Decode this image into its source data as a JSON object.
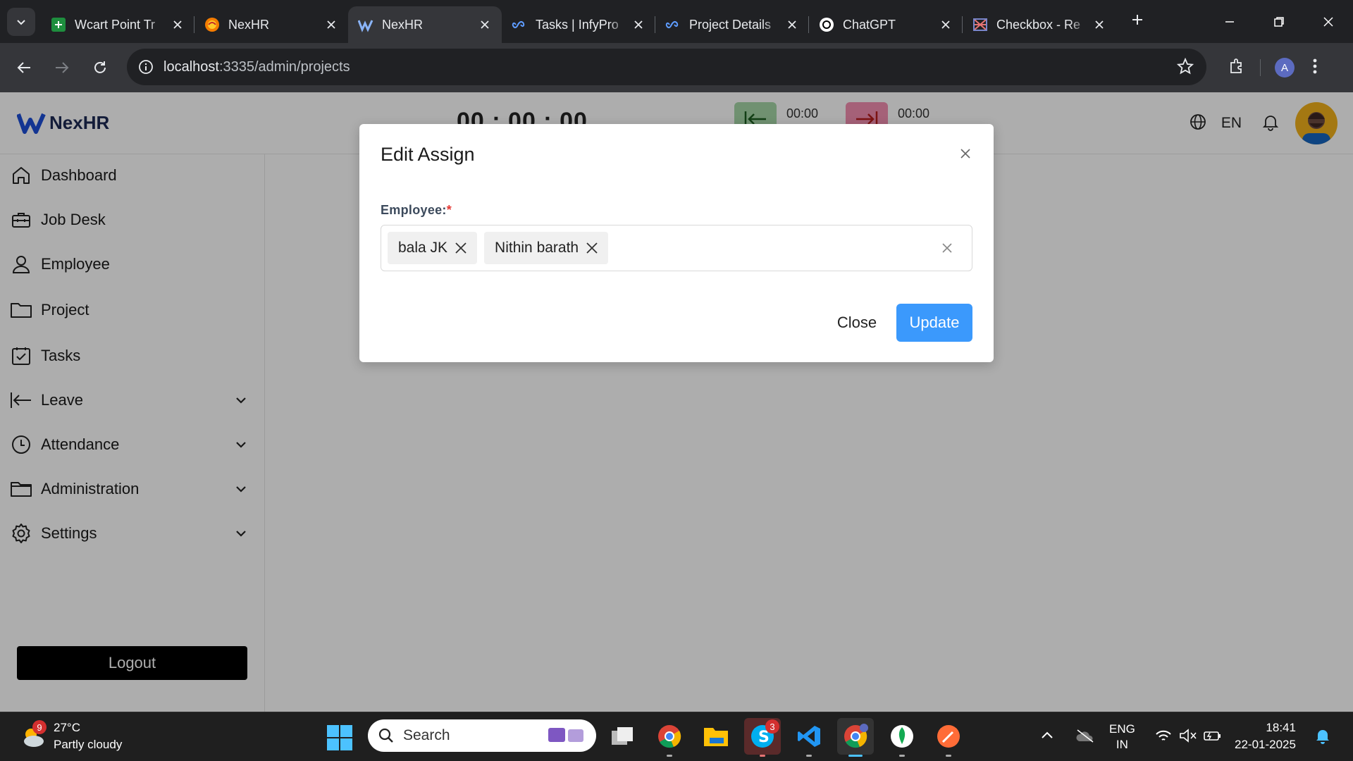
{
  "browser": {
    "tabs": [
      {
        "title": "Wcart Point Tr",
        "favicon": "sheets-icon"
      },
      {
        "title": "NexHR",
        "favicon": "nexhr-orange-icon"
      },
      {
        "title": "NexHR",
        "favicon": "nexhr-logo-icon",
        "active": true
      },
      {
        "title": "Tasks | InfyPro",
        "favicon": "infinity-icon"
      },
      {
        "title": "Project Details",
        "favicon": "infinity-icon"
      },
      {
        "title": "ChatGPT",
        "favicon": "chatgpt-icon"
      },
      {
        "title": "Checkbox - Re",
        "favicon": "react-icon"
      }
    ],
    "url_host": "localhost",
    "url_rest": ":3335/admin/projects",
    "profile_initial": "A"
  },
  "app": {
    "brand": "NexHR",
    "timer": "00 : 00 : 00",
    "punch_in_time": "00:00",
    "punch_out_time": "00:00",
    "language": "EN",
    "colors": {
      "accent": "#3b99fc",
      "punch_in": "#a5d6a7",
      "punch_out": "#f48fb1",
      "logout_bg": "#000000"
    }
  },
  "sidebar": {
    "items": [
      {
        "label": "Dashboard",
        "icon": "home-icon"
      },
      {
        "label": "Job Desk",
        "icon": "briefcase-icon"
      },
      {
        "label": "Employee",
        "icon": "user-icon"
      },
      {
        "label": "Project",
        "icon": "folder-icon"
      },
      {
        "label": "Tasks",
        "icon": "checkbox-icon"
      },
      {
        "label": "Leave",
        "icon": "arrow-left-bar-icon",
        "expandable": true
      },
      {
        "label": "Attendance",
        "icon": "clock-icon",
        "expandable": true
      },
      {
        "label": "Administration",
        "icon": "folder-icon",
        "expandable": true
      },
      {
        "label": "Settings",
        "icon": "gear-icon",
        "expandable": true
      }
    ],
    "logout_label": "Logout"
  },
  "modal": {
    "title": "Edit Assign",
    "field_label": "Employee:",
    "required_mark": "*",
    "selected": [
      "bala JK",
      "Nithin barath"
    ],
    "close_label": "Close",
    "update_label": "Update"
  },
  "taskbar": {
    "weather_temp": "27°C",
    "weather_desc": "Partly cloudy",
    "weather_badge": "9",
    "search_placeholder": "Search",
    "skype_badge": "3",
    "input_lang_1": "ENG",
    "input_lang_2": "IN",
    "time": "18:41",
    "date": "22-01-2025"
  }
}
